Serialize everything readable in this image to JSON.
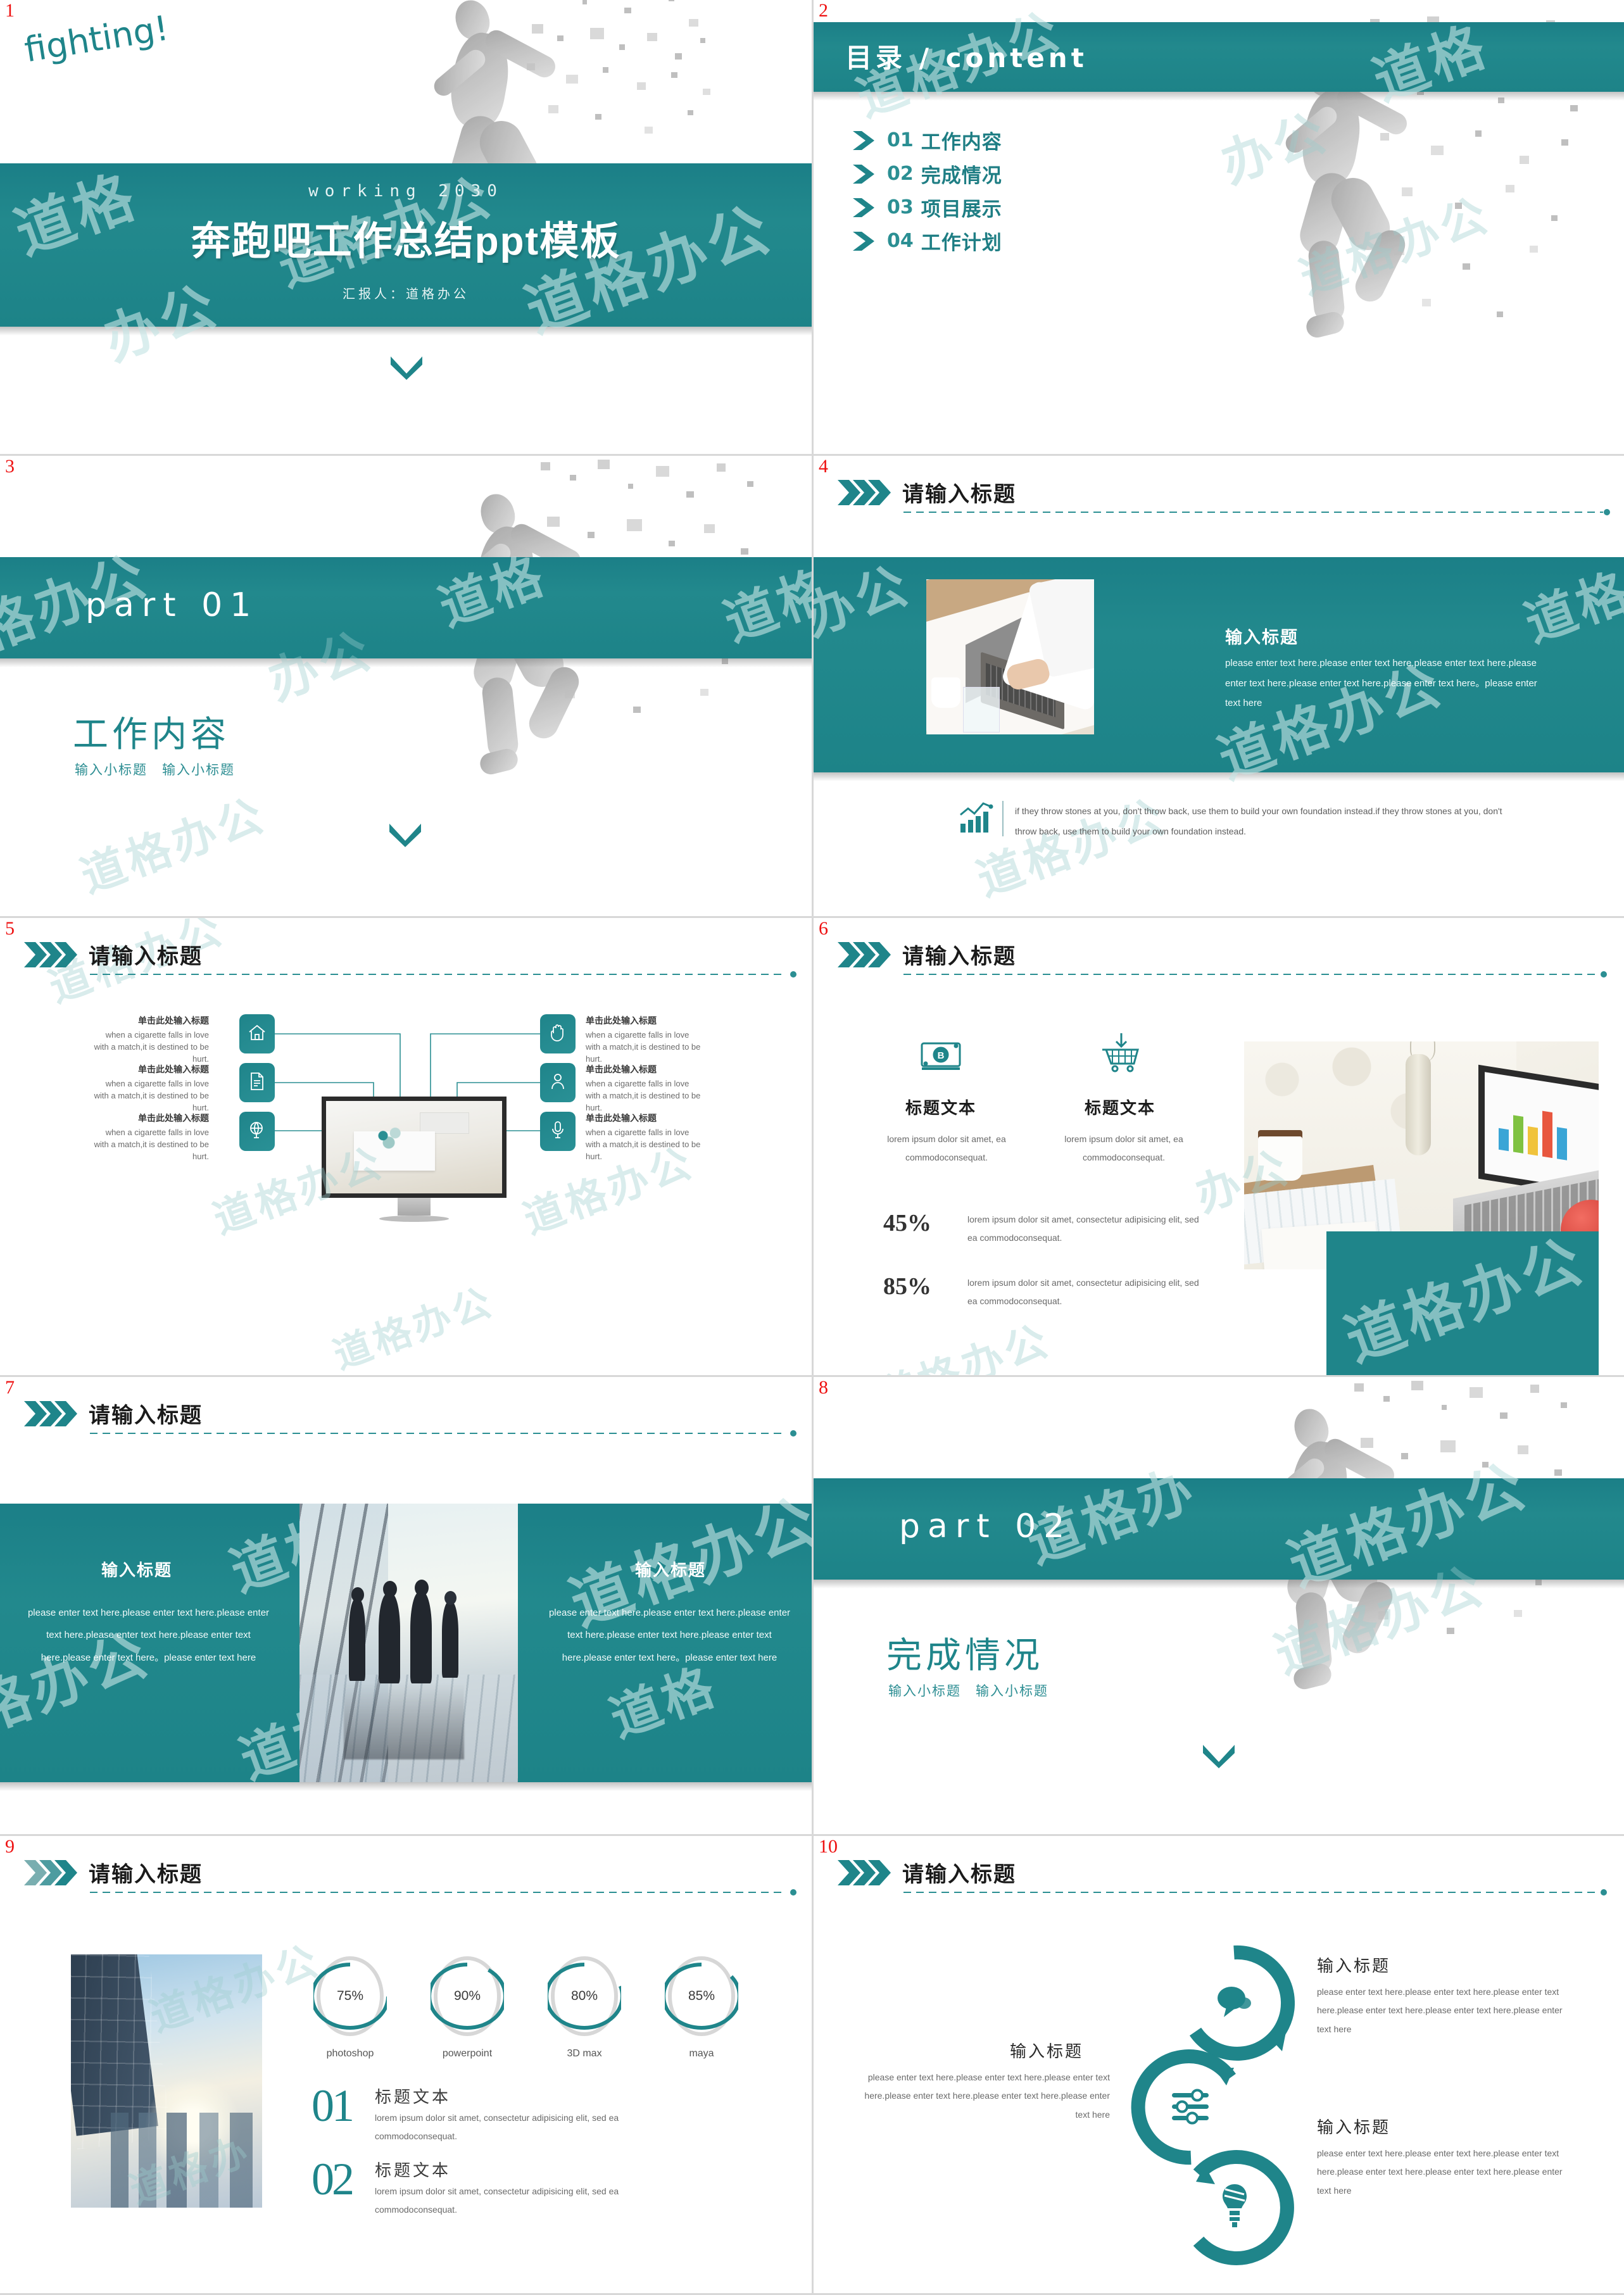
{
  "theme": {
    "teal": "#1f858a",
    "teal_dark": "#1b7f87",
    "accent_red": "#ee1111",
    "grey_text": "#6a6a6a"
  },
  "slides": [
    {
      "number": "1",
      "fighting": "fighting!",
      "working": "working  2030",
      "title": "奔跑吧工作总结ppt模板",
      "presenter": "汇报人：道格办公"
    },
    {
      "number": "2",
      "title": "目录 / content",
      "items": [
        {
          "num": "01",
          "label": "工作内容"
        },
        {
          "num": "02",
          "label": "完成情况"
        },
        {
          "num": "03",
          "label": "项目展示"
        },
        {
          "num": "04",
          "label": "工作计划"
        }
      ]
    },
    {
      "number": "3",
      "part": "part  01",
      "heading": "工作内容",
      "sub": "输入小标题　输入小标题"
    },
    {
      "number": "4",
      "header": "请输入标题",
      "right_title": "输入标题",
      "right_body": "please enter text here.please enter text here.please enter text here.please enter text here.please enter text here.please enter text here。please enter text here",
      "footer_text": "if they throw stones at you, don't throw back, use them to build your own foundation instead.if they throw stones at you, don't throw back, use them to build your own foundation instead."
    },
    {
      "number": "5",
      "header": "请输入标题",
      "nodes": [
        {
          "icon": "home-icon",
          "title": "单击此处输入标题",
          "body": "when a cigarette falls in love with a match,it is destined to be hurt.",
          "side": "left"
        },
        {
          "icon": "document-icon",
          "title": "单击此处输入标题",
          "body": "when a cigarette falls in love with a match,it is destined to be hurt.",
          "side": "left"
        },
        {
          "icon": "globe-icon",
          "title": "单击此处输入标题",
          "body": "when a cigarette falls in love with a match,it is destined to be hurt.",
          "side": "left"
        },
        {
          "icon": "hand-icon",
          "title": "单击此处输入标题",
          "body": "when a cigarette falls in love with a match,it is destined to be hurt.",
          "side": "right"
        },
        {
          "icon": "person-icon",
          "title": "单击此处输入标题",
          "body": "when a cigarette falls in love with a match,it is destined to be hurt.",
          "side": "right"
        },
        {
          "icon": "microphone-icon",
          "title": "单击此处输入标题",
          "body": "when a cigarette falls in love with a match,it is destined to be hurt.",
          "side": "right"
        }
      ]
    },
    {
      "number": "6",
      "header": "请输入标题",
      "features": [
        {
          "icon": "money-icon",
          "caption": "标题文本",
          "body": "lorem ipsum dolor sit amet, ea commodoconsequat."
        },
        {
          "icon": "cart-icon",
          "caption": "标题文本",
          "body": "lorem ipsum dolor sit amet, ea commodoconsequat."
        }
      ],
      "stats": [
        {
          "pct": "45%",
          "text": "lorem ipsum dolor sit amet, consectetur adipisicing elit, sed ea commodoconsequat."
        },
        {
          "pct": "85%",
          "text": "lorem ipsum dolor sit amet, consectetur adipisicing elit, sed ea commodoconsequat."
        }
      ]
    },
    {
      "number": "7",
      "header": "请输入标题",
      "columns": [
        {
          "title": "输入标题",
          "body": "please enter text here.please enter text here.please enter text here.please enter text here.please enter text here.please enter text here。please enter text here"
        },
        {
          "title": "输入标题",
          "body": "please enter text here.please enter text here.please enter text here.please enter text here.please enter text here.please enter text here。please enter text here"
        }
      ]
    },
    {
      "number": "8",
      "part": "part  02",
      "heading": "完成情况",
      "sub": "输入小标题　输入小标题"
    },
    {
      "number": "9",
      "header": "请输入标题",
      "rings": [
        {
          "value": "75%",
          "pct": 75,
          "label": "photoshop"
        },
        {
          "value": "90%",
          "pct": 90,
          "label": "powerpoint"
        },
        {
          "value": "80%",
          "pct": 80,
          "label": "3D max"
        },
        {
          "value": "85%",
          "pct": 85,
          "label": "maya"
        }
      ],
      "items": [
        {
          "num": "01",
          "title": "标题文本",
          "body": "lorem ipsum dolor sit amet, consectetur adipisicing elit, sed ea commodoconsequat."
        },
        {
          "num": "02",
          "title": "标题文本",
          "body": "lorem ipsum dolor sit amet, consectetur adipisicing elit, sed ea commodoconsequat."
        }
      ]
    },
    {
      "number": "10",
      "header": "请输入标题",
      "blocks": [
        {
          "icon": "speech-bubble-icon",
          "title": "输入标题",
          "body": "please enter text here.please enter text here.please enter text here.please enter text here.please enter text here.please enter text here"
        },
        {
          "icon": "sliders-icon",
          "title": "输入标题",
          "body": "please enter text here.please enter text here.please enter text here.please enter text here.please enter text here.please enter text here"
        },
        {
          "icon": "bulb-icon",
          "title": "输入标题",
          "body": "please enter text here.please enter text here.please enter text here.please enter text here.please enter text here.please enter text here"
        }
      ]
    }
  ],
  "watermark": {
    "text": "道格办公"
  },
  "chart_data": {
    "type": "bar",
    "title": "",
    "categories": [
      "photoshop",
      "powerpoint",
      "3D max",
      "maya"
    ],
    "values": [
      75,
      90,
      80,
      85
    ],
    "ylabel": "%",
    "ylim": [
      0,
      100
    ]
  }
}
